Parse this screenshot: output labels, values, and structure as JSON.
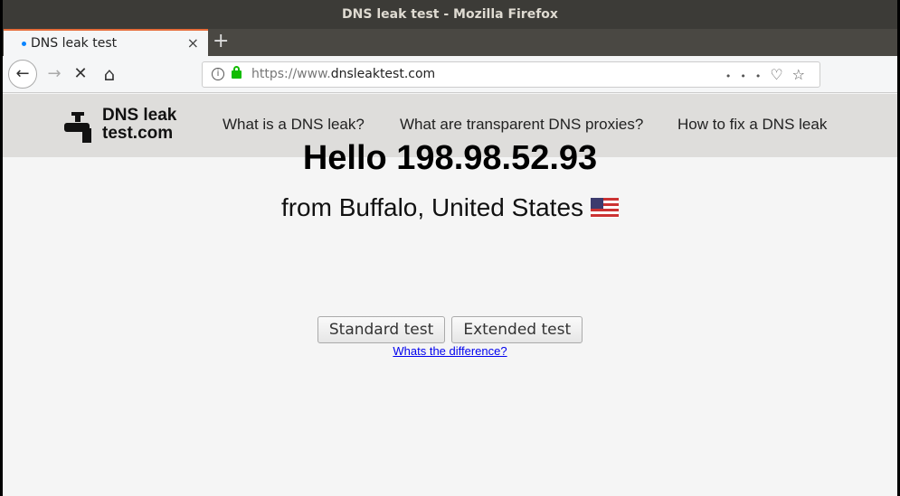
{
  "window": {
    "title": "DNS leak test - Mozilla Firefox"
  },
  "tab": {
    "label": "DNS leak test",
    "close": "×",
    "new_tab": "+"
  },
  "nav": {
    "back": "←",
    "forward": "→",
    "stop": "✕",
    "home": "⌂",
    "url_prefix": "https://www.",
    "url_domain": "dnsleaktest.com",
    "info": "i",
    "more": "•••",
    "pocket": "♡",
    "bookmark": "☆"
  },
  "site": {
    "logo_line1": "DNS leak",
    "logo_line2": "test.com",
    "menu": [
      "What is a DNS leak?",
      "What are transparent DNS proxies?",
      "How to fix a DNS leak"
    ]
  },
  "main": {
    "hello": "Hello 198.98.52.93",
    "location": "from Buffalo, United States",
    "standard_test": "Standard test",
    "extended_test": "Extended test",
    "difference_link": "Whats the difference?"
  }
}
